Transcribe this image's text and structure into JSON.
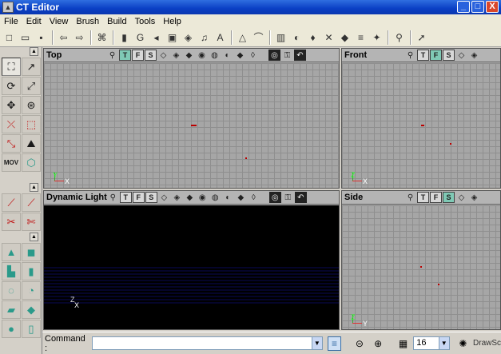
{
  "window": {
    "title": "CT Editor",
    "controls": {
      "minimize": "_",
      "maximize": "□",
      "close": "X"
    }
  },
  "menu": [
    "File",
    "Edit",
    "View",
    "Brush",
    "Build",
    "Tools",
    "Help"
  ],
  "toolbar": [
    {
      "icon": "new-file-icon",
      "glyph": "□"
    },
    {
      "icon": "open-folder-icon",
      "glyph": "▭"
    },
    {
      "icon": "save-icon",
      "glyph": "▪"
    },
    {
      "sep": true
    },
    {
      "icon": "arrow-left-icon",
      "glyph": "⇦"
    },
    {
      "icon": "arrow-right-icon",
      "glyph": "⇨"
    },
    {
      "sep": true
    },
    {
      "icon": "binoculars-icon",
      "glyph": "⌘"
    },
    {
      "sep": true
    },
    {
      "icon": "actor-icon",
      "glyph": "▮"
    },
    {
      "icon": "group-icon",
      "glyph": "G"
    },
    {
      "icon": "sound-icon",
      "glyph": "◂"
    },
    {
      "icon": "texture-browser-icon",
      "glyph": "▣"
    },
    {
      "icon": "mesh-browser-icon",
      "glyph": "◈"
    },
    {
      "icon": "music-icon",
      "glyph": "♫"
    },
    {
      "icon": "font-icon",
      "glyph": "A"
    },
    {
      "sep": true
    },
    {
      "icon": "triangle-red-icon",
      "glyph": "△"
    },
    {
      "icon": "terrain-icon",
      "glyph": "⌒"
    },
    {
      "sep": true
    },
    {
      "icon": "build-geometry-icon",
      "glyph": "▥"
    },
    {
      "icon": "build-lighting-icon",
      "glyph": "◐"
    },
    {
      "icon": "bulb-icon",
      "glyph": "♦"
    },
    {
      "icon": "paths-icon",
      "glyph": "✕"
    },
    {
      "icon": "build-all-icon",
      "glyph": "◆"
    },
    {
      "icon": "sliders-icon",
      "glyph": "≡"
    },
    {
      "icon": "light-icon",
      "glyph": "✦"
    },
    {
      "sep": true
    },
    {
      "icon": "play-figure-icon",
      "glyph": "⚲"
    },
    {
      "sep": true
    },
    {
      "icon": "pointer-icon",
      "glyph": "➚"
    }
  ],
  "viewports": {
    "top": {
      "title": "Top",
      "modes": [
        "T",
        "F",
        "S"
      ],
      "active_mode": "T"
    },
    "front": {
      "title": "Front",
      "modes": [
        "T",
        "F",
        "S"
      ],
      "active_mode": "F"
    },
    "dynamic": {
      "title": "Dynamic Light",
      "modes": [
        "T",
        "F",
        "S"
      ],
      "active_mode": ""
    },
    "side": {
      "title": "Side",
      "modes": [
        "T",
        "F",
        "S"
      ],
      "active_mode": "S"
    }
  },
  "axis_labels": {
    "y": "Y",
    "x": "X",
    "z": "Z"
  },
  "left_tools": [
    [
      "camera-move-icon",
      "move-arrow-icon"
    ],
    [
      "rotate-icon",
      "scale-icon"
    ],
    [
      "move-axes-icon",
      "texture-pan-icon"
    ],
    [
      "vertex-edit-icon",
      "select-box-icon"
    ],
    [
      "brush-clip-icon",
      "terrain-edit-icon"
    ],
    [
      "mov-icon",
      "cube-icon"
    ]
  ],
  "left_tools2": [
    [
      "line-tool-icon",
      "line-tool2-icon"
    ],
    [
      "clip-icon",
      "clip-flip-icon"
    ]
  ],
  "left_tools3": [
    [
      "cone-icon",
      "cube-brush-icon"
    ],
    [
      "stairs-icon",
      "cylinder-icon"
    ],
    [
      "spiral-stairs-icon",
      "curved-stairs-icon"
    ],
    [
      "sheet-icon",
      "tetra-icon"
    ],
    [
      "sphere-icon",
      "volume-icon"
    ]
  ],
  "statusbar": {
    "command_label": "Command :",
    "command_value": "",
    "grid_size": "16",
    "draw_label": "DrawSc"
  }
}
